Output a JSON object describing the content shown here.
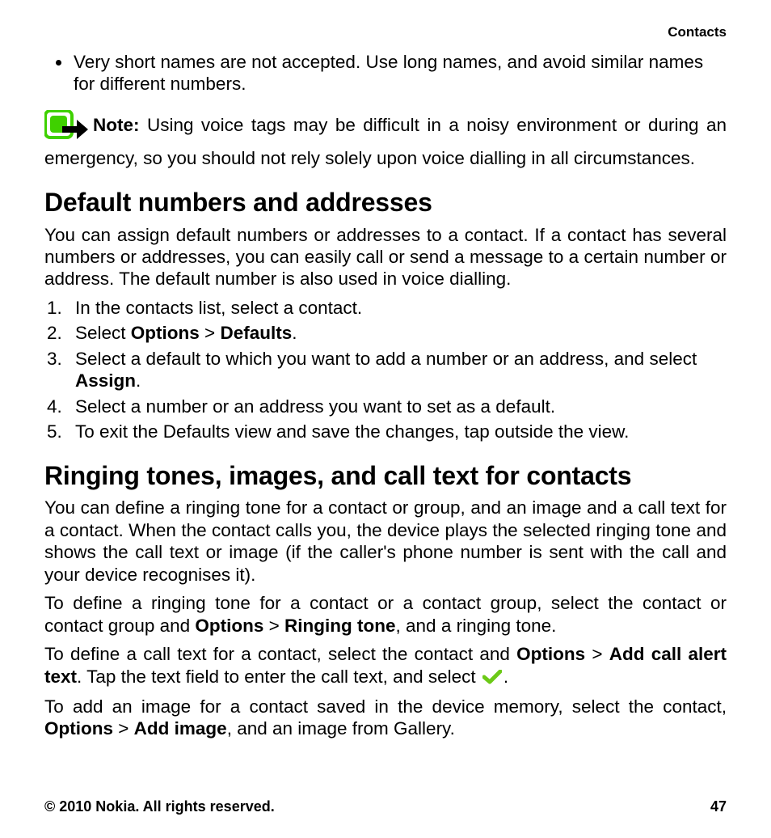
{
  "header": {
    "section": "Contacts"
  },
  "bullet": {
    "text": "Very short names are not accepted. Use long names, and avoid similar names for different numbers."
  },
  "note": {
    "label": "Note:",
    "text": "  Using voice tags may be difficult in a noisy environment or during an emergency, so you should not rely solely upon voice dialling in all circumstances."
  },
  "section1": {
    "heading": "Default numbers and addresses",
    "intro": "You can assign default numbers or addresses to a contact. If a contact has several numbers or addresses, you can easily call or send a message to a certain number or address. The default number is also used in voice dialling.",
    "steps": {
      "s1": "In the contacts list, select a contact.",
      "s2a": "Select ",
      "s2b": "Options",
      "s2c": " > ",
      "s2d": "Defaults",
      "s2e": ".",
      "s3a": "Select a default to which you want to add a number or an address, and select ",
      "s3b": "Assign",
      "s3c": ".",
      "s4": "Select a number or an address you want to set as a default.",
      "s5": "To exit the Defaults view and save the changes, tap outside the view."
    }
  },
  "section2": {
    "heading": "Ringing tones, images, and call text for contacts",
    "intro": "You can define a ringing tone for a contact or group, and an image and a call text for a contact. When the contact calls you, the device plays the selected ringing tone and shows the call text or image (if the caller's phone number is sent with the call and your device recognises it).",
    "p2a": "To define a ringing tone for a contact or a contact group, select the contact or contact group and ",
    "p2b": "Options",
    "p2c": " > ",
    "p2d": "Ringing tone",
    "p2e": ", and a ringing tone.",
    "p3a": "To define a call text for a contact, select the contact and ",
    "p3b": "Options",
    "p3c": " > ",
    "p3d": "Add call alert text",
    "p3e": ". Tap the text field to enter the call text, and select ",
    "p3f": ".",
    "p4a": "To add an image for a contact saved in the device memory, select the contact, ",
    "p4b": "Options",
    "p4c": " > ",
    "p4d": "Add image",
    "p4e": ", and an image from Gallery."
  },
  "footer": {
    "copyright": "© 2010 Nokia. All rights reserved.",
    "page": "47"
  }
}
